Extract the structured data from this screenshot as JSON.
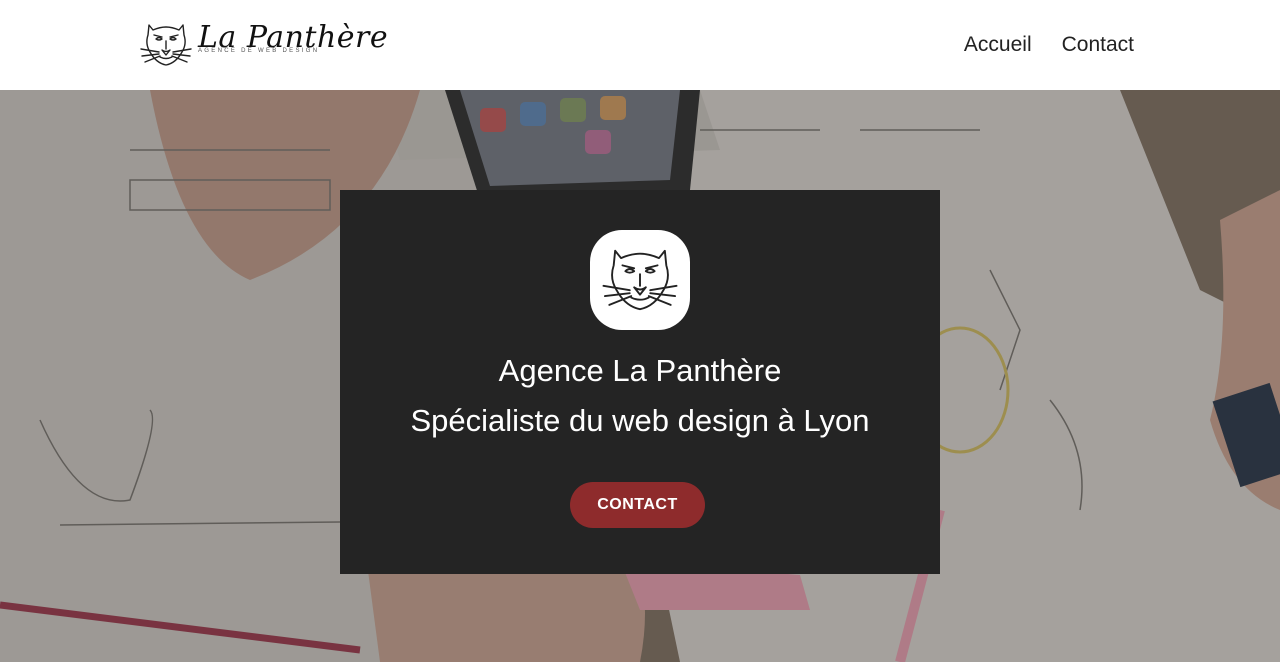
{
  "header": {
    "brand_name": "La Panthère",
    "brand_tagline": "AGENCE DE WEB DESIGN",
    "logo_icon": "panther-head-icon",
    "nav": [
      {
        "label": "Accueil"
      },
      {
        "label": "Contact"
      }
    ]
  },
  "hero": {
    "background": "desk-sketches-photo",
    "card": {
      "logo_icon": "panther-head-icon",
      "title": "Agence La Panthère",
      "subtitle": "Spécialiste du web design à Lyon",
      "button_label": "CONTACT"
    }
  },
  "colors": {
    "header_bg": "#ffffff",
    "card_bg": "#242424",
    "button_bg": "#8e2b2c",
    "text_light": "#ffffff",
    "nav_text": "#222222"
  }
}
